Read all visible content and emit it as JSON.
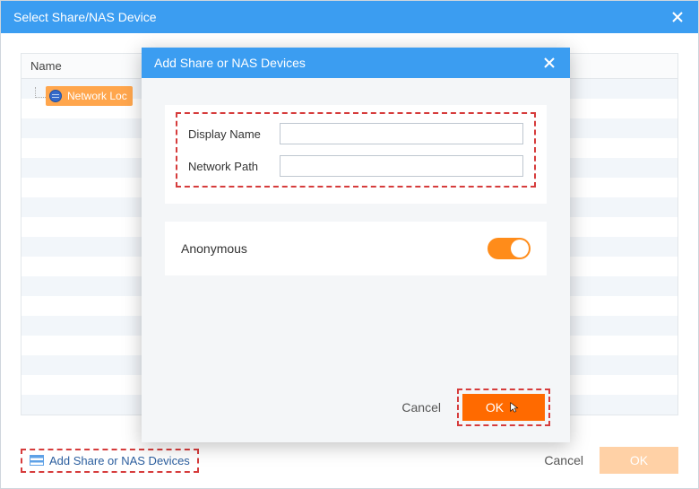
{
  "outer": {
    "title": "Select Share/NAS Device",
    "list_header": "Name",
    "selected_item": "Network Loc",
    "add_link": "Add Share or NAS Devices",
    "cancel": "Cancel",
    "ok": "OK"
  },
  "modal": {
    "title": "Add Share or NAS Devices",
    "display_name_label": "Display Name",
    "display_name_value": "",
    "network_path_label": "Network Path",
    "network_path_value": "",
    "anonymous_label": "Anonymous",
    "anonymous_on": true,
    "cancel": "Cancel",
    "ok": "OK"
  },
  "colors": {
    "primary_blue": "#3b9df1",
    "accent_orange": "#ff6a00",
    "highlight_dashed": "#d63c3c"
  }
}
